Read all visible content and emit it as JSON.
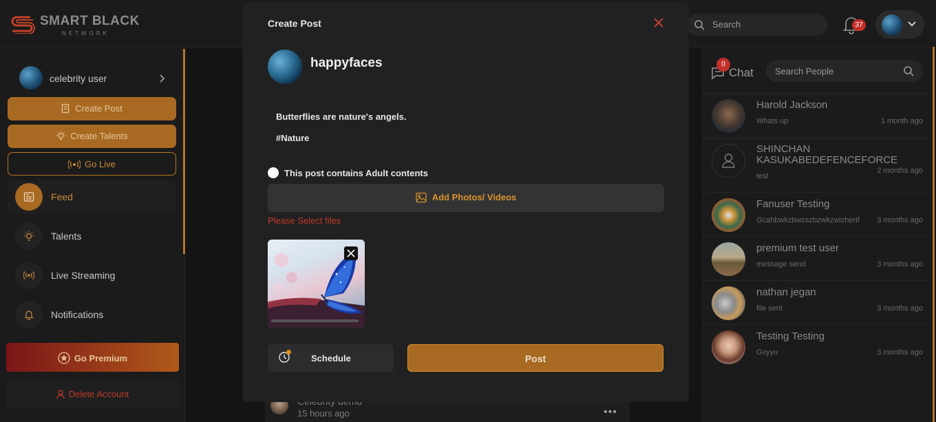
{
  "brand": {
    "name": "SMART BLACK",
    "tagline": "NETWORK",
    "accent": "#b8772a"
  },
  "header": {
    "search_placeholder": "Search",
    "notification_count": "37"
  },
  "sidebar": {
    "user_name": "celebrity user",
    "create_post_label": "Create Post",
    "create_talents_label": "Create Talents",
    "go_live_label": "Go Live",
    "nav": [
      {
        "label": "Feed",
        "icon": "newspaper-icon"
      },
      {
        "label": "Talents",
        "icon": "bulb-icon"
      },
      {
        "label": "Live Streaming",
        "icon": "broadcast-icon"
      },
      {
        "label": "Notifications",
        "icon": "bell-icon"
      }
    ],
    "premium_label": "Go Premium",
    "delete_label": "Delete Account"
  },
  "feed": {
    "author": "Celebrity demo",
    "time": "15 hours ago"
  },
  "chat": {
    "title": "Chat",
    "unread_count": "0",
    "search_placeholder": "Search People",
    "contacts": [
      {
        "name": "Harold Jackson",
        "message": "Whats up",
        "time": "1 month ago"
      },
      {
        "name": "SHINCHAN KASUKABEDEFENCEFORCE",
        "message": "test",
        "time": "2 months ago"
      },
      {
        "name": "Fanuser Testing",
        "message": "Gcahbwkzbwzszbzwkzwizherif",
        "time": "3 months ago"
      },
      {
        "name": "premium test user",
        "message": "message send",
        "time": "3 months ago"
      },
      {
        "name": "nathan jegan",
        "message": "file sent",
        "time": "3 months ago"
      },
      {
        "name": "Testing Testing",
        "message": "Gvyyu",
        "time": "3 months ago"
      }
    ]
  },
  "modal": {
    "title": "Create Post",
    "username": "happyfaces",
    "text_line1": "Butterflies are nature's angels.",
    "text_line2": "#Nature",
    "adult_label": "This post contains Adult contents",
    "add_media_label": "Add Photos/ Videos",
    "error": "Please Select files",
    "schedule_label": "Schedule",
    "post_label": "Post"
  }
}
